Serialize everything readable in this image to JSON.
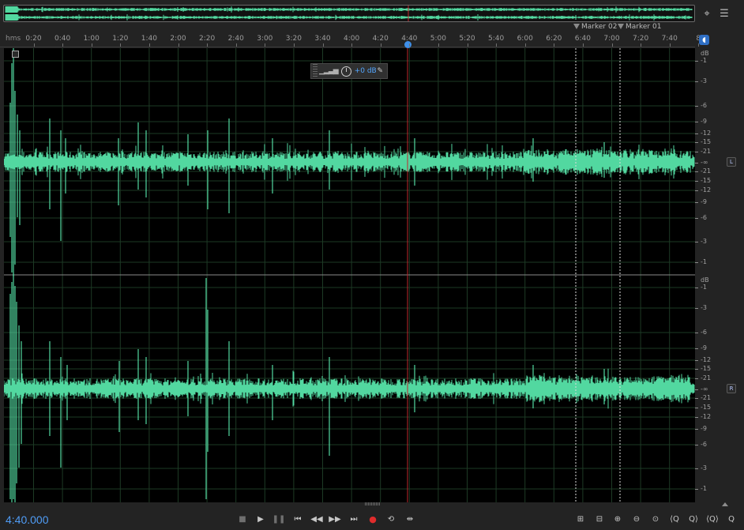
{
  "overview": {
    "label": "overview-waveform"
  },
  "icons": {
    "zoom_selection": "zoom-selection-icon",
    "menu": "panel-menu-icon"
  },
  "markers": [
    {
      "label": "Marker 02",
      "time": "6:40"
    },
    {
      "label": "Marker 01",
      "time": "7:10"
    }
  ],
  "ruler": {
    "unit": "hms",
    "ticks": [
      "0:20",
      "0:40",
      "1:00",
      "1:20",
      "1:40",
      "2:00",
      "2:20",
      "2:40",
      "3:00",
      "3:20",
      "3:40",
      "4:00",
      "4:20",
      "4:40",
      "5:00",
      "5:20",
      "5:40",
      "6:00",
      "6:20",
      "6:40",
      "7:00",
      "7:20",
      "7:40",
      "8"
    ],
    "playhead": "4:40"
  },
  "hud": {
    "gain": "+0 dB"
  },
  "db_scale": {
    "unit": "dB",
    "labels": [
      "-1",
      "-3",
      "-6",
      "-9",
      "-12",
      "-15",
      "-21",
      "-∞",
      "-21",
      "-15",
      "-12",
      "-9",
      "-6",
      "-3",
      "-1"
    ]
  },
  "channels": [
    {
      "badge": "L"
    },
    {
      "badge": "R"
    }
  ],
  "transport": {
    "time": "4:40.000"
  },
  "colors": {
    "waveform": "#52d8a0",
    "playhead": "#c0272d",
    "time": "#4f9cf5",
    "record": "#e02c2c"
  }
}
